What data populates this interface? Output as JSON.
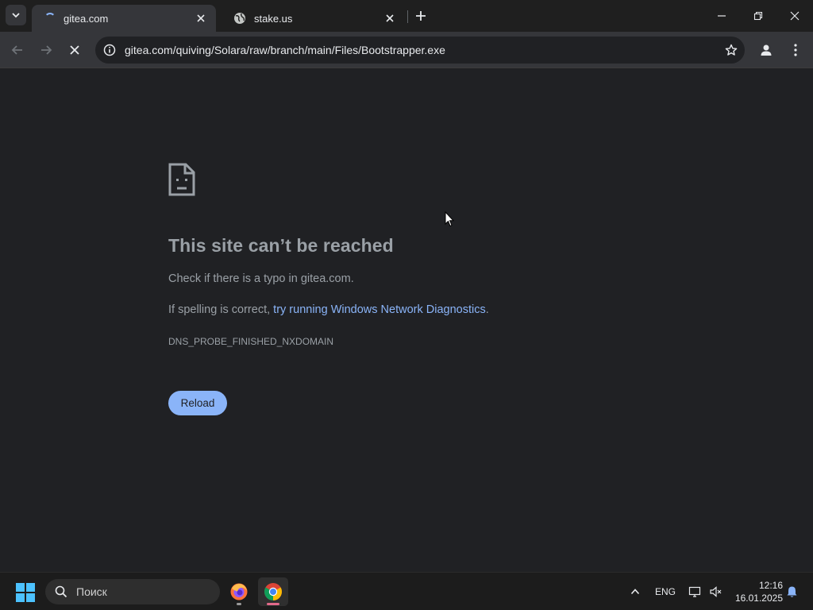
{
  "browser": {
    "tabs": [
      {
        "title": "gitea.com",
        "active": true
      },
      {
        "title": "stake.us",
        "active": false
      }
    ],
    "address_bar": {
      "url": "gitea.com/quiving/Solara/raw/branch/main/Files/Bootstrapper.exe"
    }
  },
  "error_page": {
    "title": "This site can’t be reached",
    "line1": "Check if there is a typo in gitea.com.",
    "line2_prefix": "If spelling is correct, ",
    "line2_link": "try running Windows Network Diagnostics",
    "line2_suffix": ".",
    "error_code": "DNS_PROBE_FINISHED_NXDOMAIN",
    "reload_label": "Reload"
  },
  "taskbar": {
    "search_placeholder": "Поиск",
    "language": "ENG",
    "time": "12:16",
    "date": "16.01.2025",
    "apps": [
      {
        "icon": "firefox-icon"
      },
      {
        "icon": "chrome-icon",
        "active": true
      }
    ]
  },
  "colors": {
    "page_bg": "#202124",
    "link": "#8ab4f8",
    "reload_button": "#8ab4f8",
    "muted_text": "#9aa0a6"
  }
}
